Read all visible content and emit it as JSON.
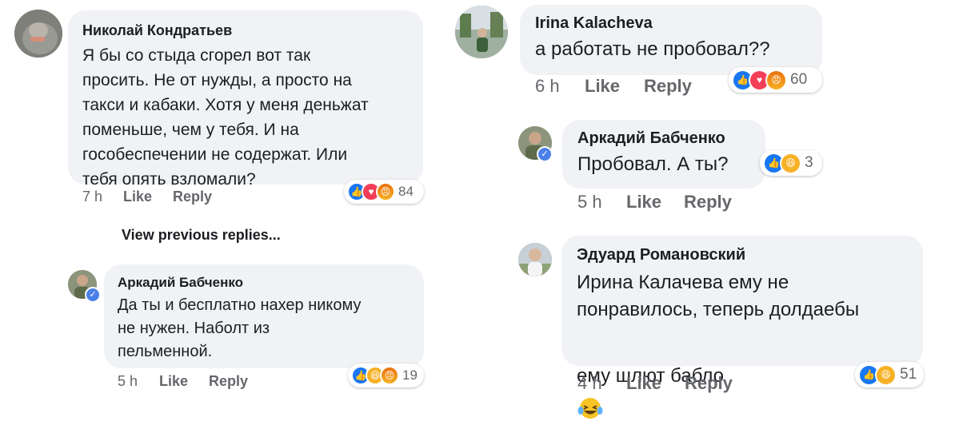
{
  "left": {
    "c1": {
      "author": "Николай Кондратьев",
      "text": "Я бы со стыда сгорел вот так\nпросить. Не от нужды, а просто на\nтакси и кабаки. Хотя у меня деньжат\nпоменьше, чем у тебя. И на\nгособеспечении не содержат. Или\nтебя опять взломали?",
      "time": "7 h",
      "like": "Like",
      "reply": "Reply",
      "reactions": [
        "like",
        "love",
        "angry"
      ],
      "reaction_count": "84"
    },
    "view_previous": "View previous replies...",
    "c2": {
      "author": "Аркадий Бабченко",
      "text": "Да ты и бесплатно нахер никому\nне нужен. Наболт из\nпельменной.",
      "time": "5 h",
      "like": "Like",
      "reply": "Reply",
      "reactions": [
        "like",
        "haha",
        "angry"
      ],
      "reaction_count": "19"
    }
  },
  "right": {
    "c1": {
      "author": "Irina  Kalacheva",
      "text": "а работать не пробовал??",
      "time": "6 h",
      "like": "Like",
      "reply": "Reply",
      "reactions": [
        "like",
        "love",
        "angry"
      ],
      "reaction_count": "60"
    },
    "c2": {
      "author": "Аркадий Бабченко",
      "text": "Пробовал. А ты?",
      "time": "5 h",
      "like": "Like",
      "reply": "Reply",
      "reactions": [
        "like",
        "haha"
      ],
      "reaction_count": "3"
    },
    "c3": {
      "author": "Эдуард Романовский",
      "text_line1": "Ирина Калачева ему не",
      "text_line2": "понравилось, теперь долдаебы",
      "text_line3": "ему шлют бабло",
      "emoji": "laughing-tears-icon",
      "time": "4 h",
      "like": "Like",
      "reply": "Reply",
      "reactions": [
        "like",
        "haha"
      ],
      "reaction_count": "51"
    }
  },
  "colors": {
    "bubble": "#f0f2f5",
    "like": "#1877f2",
    "love": "#f33e58",
    "haha": "#f7b125",
    "meta": "#65676b"
  }
}
